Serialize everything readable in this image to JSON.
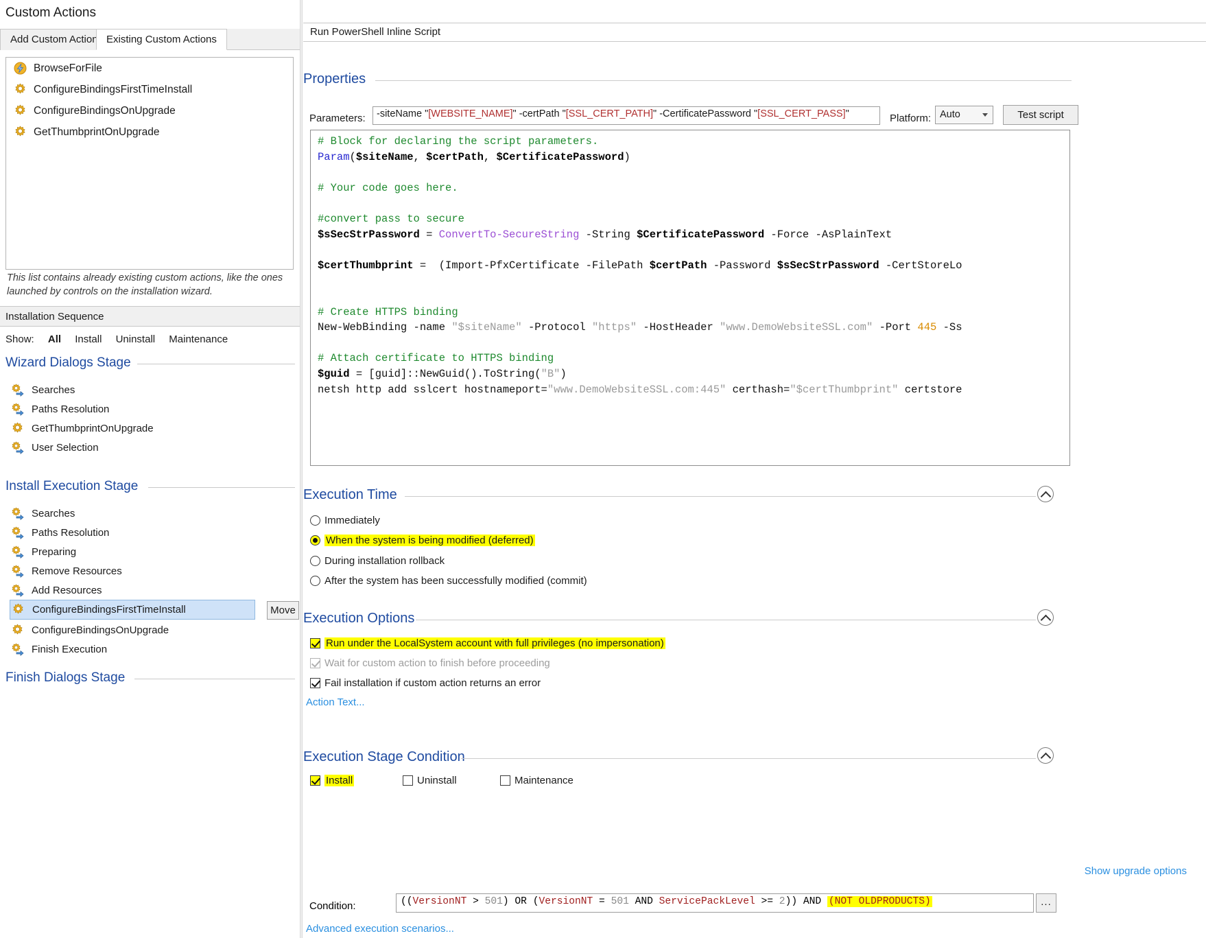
{
  "window": {
    "title": "Custom Actions"
  },
  "tabs": [
    {
      "label": "Add Custom Action",
      "active": false
    },
    {
      "label": "Existing Custom Actions",
      "active": true
    }
  ],
  "existing_actions": [
    {
      "label": "BrowseForFile",
      "icon": "lightning-icon"
    },
    {
      "label": "ConfigureBindingsFirstTimeInstall",
      "icon": "gear-icon"
    },
    {
      "label": "ConfigureBindingsOnUpgrade",
      "icon": "gear-icon"
    },
    {
      "label": "GetThumbprintOnUpgrade",
      "icon": "gear-icon"
    }
  ],
  "hint": "This list contains already existing custom actions, like the ones launched by controls on the installation wizard.",
  "sequence": {
    "header": "Installation Sequence",
    "show_label": "Show:",
    "show_options": [
      {
        "label": "All",
        "selected": true
      },
      {
        "label": "Install",
        "selected": false
      },
      {
        "label": "Uninstall",
        "selected": false
      },
      {
        "label": "Maintenance",
        "selected": false
      }
    ],
    "stages": [
      {
        "name": "Wizard Dialogs Stage",
        "items": [
          {
            "label": "Searches",
            "icon": "gear-arrow-icon",
            "selected": false
          },
          {
            "label": "Paths Resolution",
            "icon": "gear-arrow-icon",
            "selected": false
          },
          {
            "label": "GetThumbprintOnUpgrade",
            "icon": "gear-icon",
            "selected": false
          },
          {
            "label": "User Selection",
            "icon": "gear-arrow-icon",
            "selected": false
          }
        ]
      },
      {
        "name": "Install Execution Stage",
        "items": [
          {
            "label": "Searches",
            "icon": "gear-arrow-icon",
            "selected": false
          },
          {
            "label": "Paths Resolution",
            "icon": "gear-arrow-icon",
            "selected": false
          },
          {
            "label": "Preparing",
            "icon": "gear-arrow-icon",
            "selected": false
          },
          {
            "label": "Remove Resources",
            "icon": "gear-arrow-icon",
            "selected": false
          },
          {
            "label": "Add Resources",
            "icon": "gear-arrow-icon",
            "selected": false
          },
          {
            "label": "ConfigureBindingsFirstTimeInstall",
            "icon": "gear-icon",
            "selected": true
          },
          {
            "label": "ConfigureBindingsOnUpgrade",
            "icon": "gear-icon",
            "selected": false
          },
          {
            "label": "Finish Execution",
            "icon": "gear-arrow-icon",
            "selected": false
          }
        ]
      },
      {
        "name": "Finish Dialogs Stage",
        "items": []
      }
    ],
    "move_button": "Move"
  },
  "detail": {
    "title": "Run PowerShell Inline Script",
    "properties": {
      "section_title": "Properties",
      "parameters_label": "Parameters:",
      "parameters_value": "-siteName \"[WEBSITE_NAME]\" -certPath \"[SSL_CERT_PATH]\" -CertificatePassword \"[SSL_CERT_PASS]\"",
      "platform_label": "Platform:",
      "platform_value": "Auto",
      "test_script_label": "Test script"
    },
    "script": "# Block for declaring the script parameters.\nParam($siteName, $certPath, $CertificatePassword)\n\n# Your code goes here.\n\n#convert pass to secure\n$sSecStrPassword = ConvertTo-SecureString -String $CertificatePassword -Force -AsPlainText\n\n$certThumbprint =  (Import-PfxCertificate -FilePath $certPath -Password $sSecStrPassword -CertStoreLo\n\n\n# Create HTTPS binding\nNew-WebBinding -name \"$siteName\" -Protocol \"https\" -HostHeader \"www.DemoWebsiteSSL.com\" -Port 445 -Ss\n\n# Attach certificate to HTTPS binding\n$guid = [guid]::NewGuid().ToString(\"B\")\nnetsh http add sslcert hostnameport=\"www.DemoWebsiteSSL.com:445\" certhash=\"$certThumbprint\" certstore",
    "execution_time": {
      "section_title": "Execution Time",
      "options": [
        {
          "label": "Immediately",
          "selected": false,
          "highlighted": false
        },
        {
          "label": "When the system is being modified (deferred)",
          "selected": true,
          "highlighted": true
        },
        {
          "label": "During installation rollback",
          "selected": false,
          "highlighted": false
        },
        {
          "label": "After the system has been successfully modified (commit)",
          "selected": false,
          "highlighted": false
        }
      ]
    },
    "execution_options": {
      "section_title": "Execution Options",
      "options": [
        {
          "label": "Run under the LocalSystem account with full privileges (no impersonation)",
          "checked": true,
          "disabled": false,
          "highlighted": true
        },
        {
          "label": "Wait for custom action to finish before proceeding",
          "checked": true,
          "disabled": true,
          "highlighted": false
        },
        {
          "label": "Fail installation if custom action returns an error",
          "checked": true,
          "disabled": false,
          "highlighted": false
        }
      ],
      "action_text_link": "Action Text..."
    },
    "execution_stage_condition": {
      "section_title": "Execution Stage Condition",
      "stages": [
        {
          "label": "Install",
          "checked": true,
          "highlighted": true
        },
        {
          "label": "Uninstall",
          "checked": false,
          "highlighted": false
        },
        {
          "label": "Maintenance",
          "checked": false,
          "highlighted": false
        }
      ],
      "upgrade_link": "Show upgrade options",
      "condition_label": "Condition:",
      "condition_value": "((VersionNT > 501) OR (VersionNT = 501 AND ServicePackLevel >= 2)) AND (NOT OLDPRODUCTS)",
      "condition_highlight": "(NOT OLDPRODUCTS)",
      "condition_button": "...",
      "advanced_link": "Advanced execution scenarios..."
    }
  },
  "colors": {
    "section_heading": "#1f4ba0",
    "link": "#2a8fe0",
    "highlight": "#ffff00",
    "selection": "#cfe2f8"
  }
}
